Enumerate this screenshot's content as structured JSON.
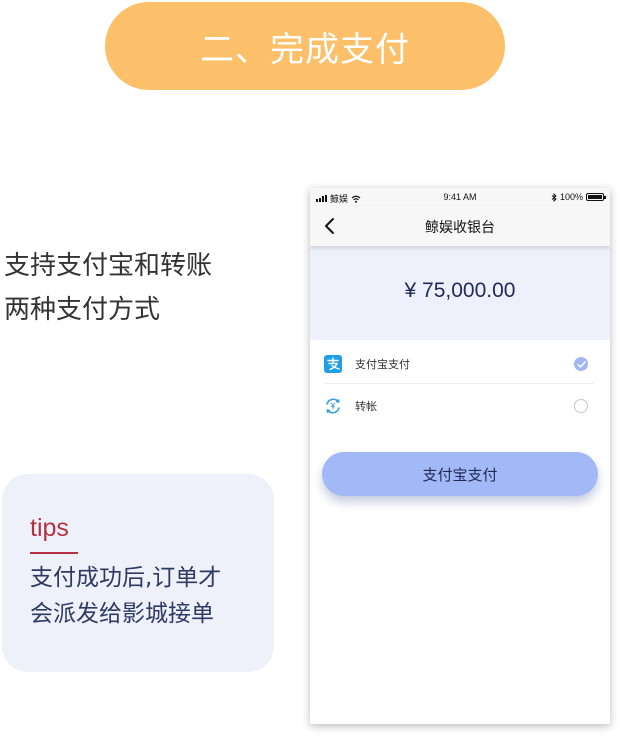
{
  "banner": {
    "title": "二、完成支付"
  },
  "description": {
    "line1": "支持支付宝和转账",
    "line2": "两种支付方式"
  },
  "tips": {
    "title": "tips",
    "line1": "支付成功后,订单才",
    "line2": "会派发给影城接单",
    "accent_color": "#b5313f"
  },
  "phone": {
    "status_bar": {
      "carrier": "鲸娱",
      "time": "9:41 AM",
      "battery": "100%"
    },
    "nav": {
      "title": "鲸娱收银台",
      "back_icon": "chevron-left-icon"
    },
    "amount": "¥ 75,000.00",
    "options": [
      {
        "label": "支付宝支付",
        "icon": "alipay-icon",
        "selected": true
      },
      {
        "label": "转帐",
        "icon": "transfer-icon",
        "selected": false
      }
    ],
    "pay_button": "支付宝支付"
  },
  "colors": {
    "banner": "#fdc06a",
    "tips_bg": "#eef1f9",
    "amount_bg": "#eef1fc",
    "button": "#a3b8f6",
    "text_dark": "#1f2a55"
  }
}
